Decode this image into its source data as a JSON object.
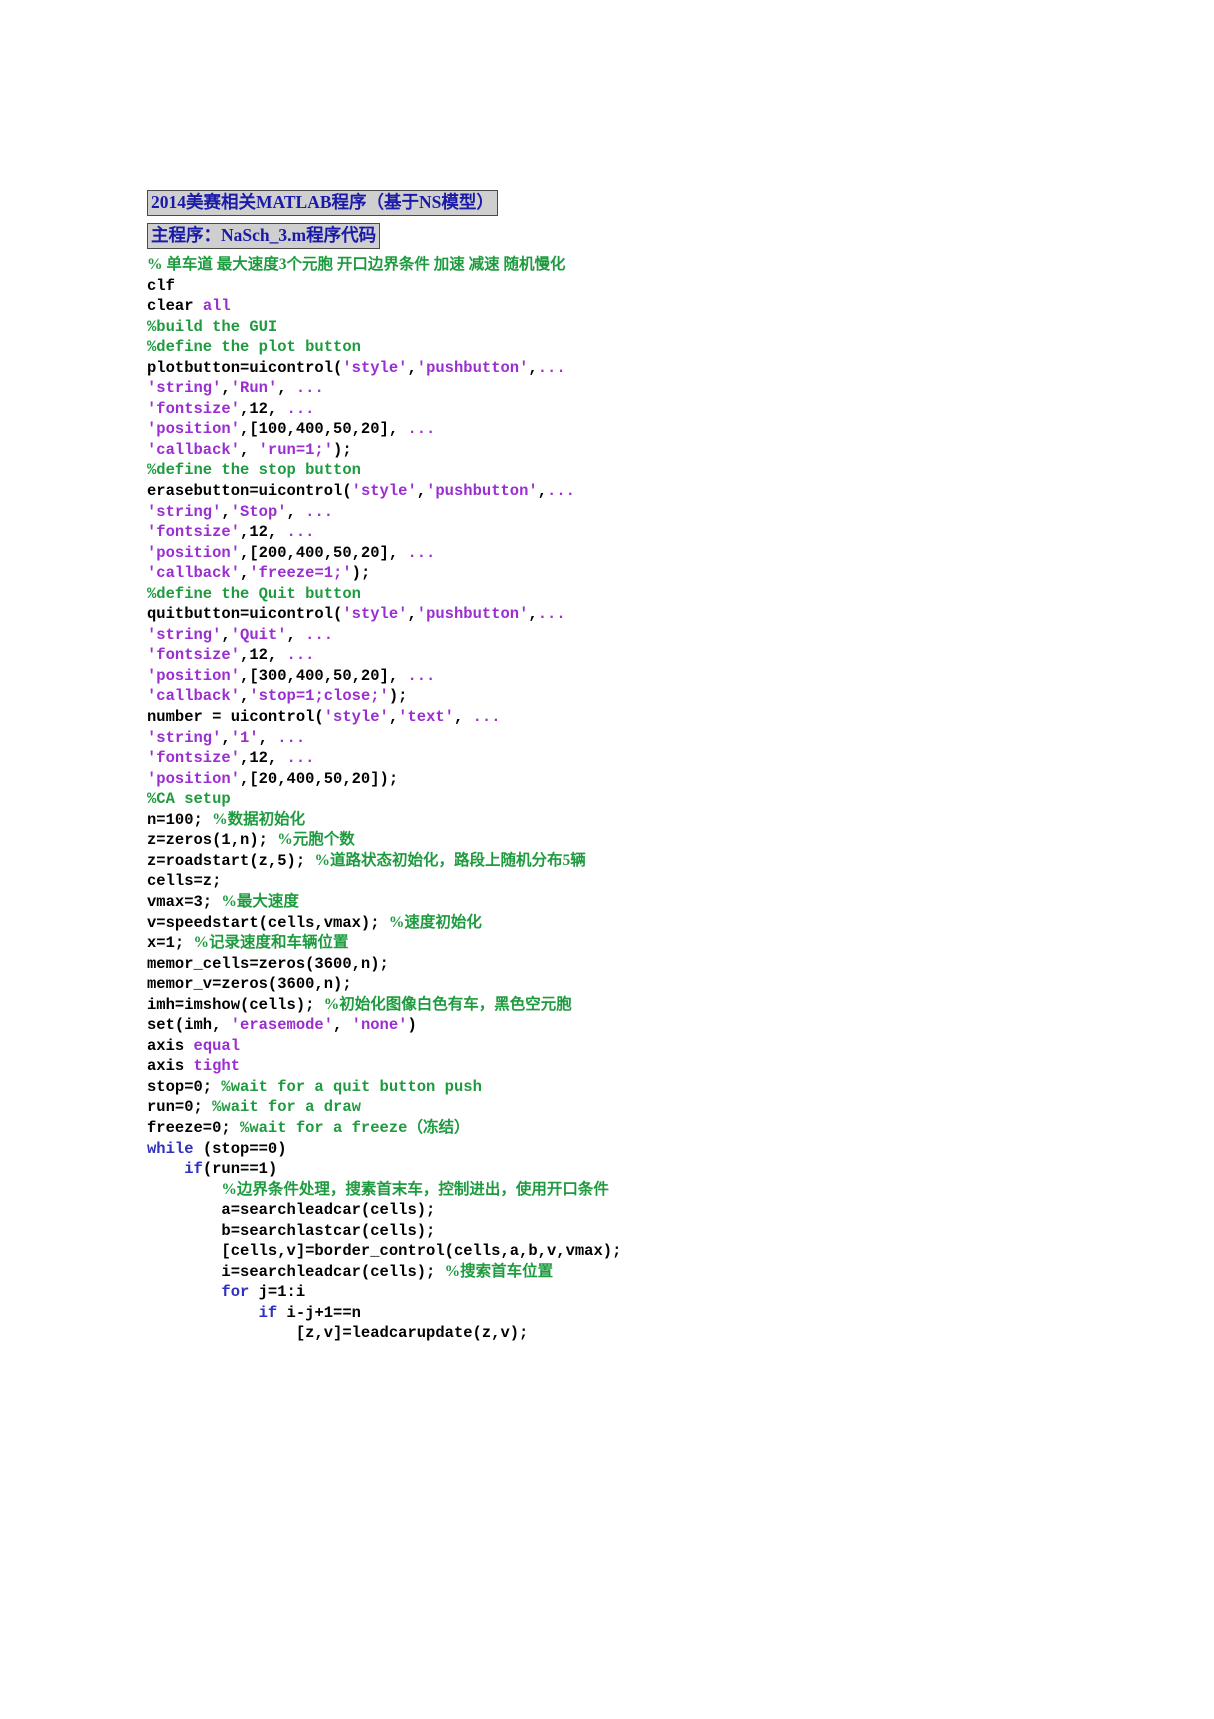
{
  "document": {
    "title_boxes": [
      "2014美赛相关MATLAB程序（基于NS模型）",
      "主程序：NaSch_3.m程序代码"
    ]
  },
  "code": {
    "language": "matlab",
    "lines": [
      [
        [
          "cmz",
          "% 单车道 最大速度3个元胞 开口边界条件 加速 减速 随机慢化"
        ]
      ],
      [
        [
          "pl",
          "clf"
        ]
      ],
      [
        [
          "pl",
          "clear "
        ],
        [
          "kw",
          "all"
        ]
      ],
      [
        [
          "cm",
          "%build the GUI"
        ]
      ],
      [
        [
          "cm",
          "%define the plot button"
        ]
      ],
      [
        [
          "pl",
          "plotbutton=uicontrol("
        ],
        [
          "st",
          "'style'"
        ],
        [
          "pl",
          ","
        ],
        [
          "st",
          "'pushbutton'"
        ],
        [
          "pl",
          ","
        ],
        [
          "st",
          "..."
        ]
      ],
      [
        [
          "st",
          "'string'"
        ],
        [
          "pl",
          ","
        ],
        [
          "st",
          "'Run'"
        ],
        [
          "pl",
          ", "
        ],
        [
          "st",
          "..."
        ]
      ],
      [
        [
          "st",
          "'fontsize'"
        ],
        [
          "pl",
          ",12, "
        ],
        [
          "st",
          "..."
        ]
      ],
      [
        [
          "st",
          "'position'"
        ],
        [
          "pl",
          ",[100,400,50,20], "
        ],
        [
          "st",
          "..."
        ]
      ],
      [
        [
          "st",
          "'callback'"
        ],
        [
          "pl",
          ", "
        ],
        [
          "st",
          "'run=1;'"
        ],
        [
          "pl",
          ");"
        ]
      ],
      [
        [
          "cm",
          "%define the stop button"
        ]
      ],
      [
        [
          "pl",
          "erasebutton=uicontrol("
        ],
        [
          "st",
          "'style'"
        ],
        [
          "pl",
          ","
        ],
        [
          "st",
          "'pushbutton'"
        ],
        [
          "pl",
          ","
        ],
        [
          "st",
          "..."
        ]
      ],
      [
        [
          "st",
          "'string'"
        ],
        [
          "pl",
          ","
        ],
        [
          "st",
          "'Stop'"
        ],
        [
          "pl",
          ", "
        ],
        [
          "st",
          "..."
        ]
      ],
      [
        [
          "st",
          "'fontsize'"
        ],
        [
          "pl",
          ",12, "
        ],
        [
          "st",
          "..."
        ]
      ],
      [
        [
          "st",
          "'position'"
        ],
        [
          "pl",
          ",[200,400,50,20], "
        ],
        [
          "st",
          "..."
        ]
      ],
      [
        [
          "st",
          "'callback'"
        ],
        [
          "pl",
          ","
        ],
        [
          "st",
          "'freeze=1;'"
        ],
        [
          "pl",
          ");"
        ]
      ],
      [
        [
          "cm",
          "%define the Quit button"
        ]
      ],
      [
        [
          "pl",
          "quitbutton=uicontrol("
        ],
        [
          "st",
          "'style'"
        ],
        [
          "pl",
          ","
        ],
        [
          "st",
          "'pushbutton'"
        ],
        [
          "pl",
          ","
        ],
        [
          "st",
          "..."
        ]
      ],
      [
        [
          "st",
          "'string'"
        ],
        [
          "pl",
          ","
        ],
        [
          "st",
          "'Quit'"
        ],
        [
          "pl",
          ", "
        ],
        [
          "st",
          "..."
        ]
      ],
      [
        [
          "st",
          "'fontsize'"
        ],
        [
          "pl",
          ",12, "
        ],
        [
          "st",
          "..."
        ]
      ],
      [
        [
          "st",
          "'position'"
        ],
        [
          "pl",
          ",[300,400,50,20], "
        ],
        [
          "st",
          "..."
        ]
      ],
      [
        [
          "st",
          "'callback'"
        ],
        [
          "pl",
          ","
        ],
        [
          "st",
          "'stop=1;close;'"
        ],
        [
          "pl",
          ");"
        ]
      ],
      [
        [
          "pl",
          "number = uicontrol("
        ],
        [
          "st",
          "'style'"
        ],
        [
          "pl",
          ","
        ],
        [
          "st",
          "'text'"
        ],
        [
          "pl",
          ", "
        ],
        [
          "st",
          "..."
        ]
      ],
      [
        [
          "st",
          "'string'"
        ],
        [
          "pl",
          ","
        ],
        [
          "st",
          "'1'"
        ],
        [
          "pl",
          ", "
        ],
        [
          "st",
          "..."
        ]
      ],
      [
        [
          "st",
          "'fontsize'"
        ],
        [
          "pl",
          ",12, "
        ],
        [
          "st",
          "..."
        ]
      ],
      [
        [
          "st",
          "'position'"
        ],
        [
          "pl",
          ",[20,400,50,20]);"
        ]
      ],
      [
        [
          "cm",
          "%CA setup"
        ]
      ],
      [
        [
          "pl",
          "n=100; "
        ],
        [
          "cmz",
          "%数据初始化"
        ]
      ],
      [
        [
          "pl",
          "z=zeros(1,n); "
        ],
        [
          "cmz",
          "%元胞个数"
        ]
      ],
      [
        [
          "pl",
          "z=roadstart(z,5); "
        ],
        [
          "cmz",
          "%道路状态初始化，路段上随机分布5辆"
        ]
      ],
      [
        [
          "pl",
          "cells=z;"
        ]
      ],
      [
        [
          "pl",
          "vmax=3; "
        ],
        [
          "cmz",
          "%最大速度"
        ]
      ],
      [
        [
          "pl",
          "v=speedstart(cells,vmax); "
        ],
        [
          "cmz",
          "%速度初始化"
        ]
      ],
      [
        [
          "pl",
          "x=1; "
        ],
        [
          "cmz",
          "%记录速度和车辆位置"
        ]
      ],
      [
        [
          "pl",
          "memor_cells=zeros(3600,n);"
        ]
      ],
      [
        [
          "pl",
          "memor_v=zeros(3600,n);"
        ]
      ],
      [
        [
          "pl",
          "imh=imshow(cells); "
        ],
        [
          "cmz",
          "%初始化图像白色有车，黑色空元胞"
        ]
      ],
      [
        [
          "pl",
          "set(imh, "
        ],
        [
          "st",
          "'erasemode'"
        ],
        [
          "pl",
          ", "
        ],
        [
          "st",
          "'none'"
        ],
        [
          "pl",
          ")"
        ]
      ],
      [
        [
          "pl",
          "axis "
        ],
        [
          "kw",
          "equal"
        ]
      ],
      [
        [
          "pl",
          "axis "
        ],
        [
          "kw",
          "tight"
        ]
      ],
      [
        [
          "pl",
          "stop=0; "
        ],
        [
          "cm",
          "%wait for a quit button push"
        ]
      ],
      [
        [
          "pl",
          "run=0; "
        ],
        [
          "cm",
          "%wait for a draw"
        ]
      ],
      [
        [
          "pl",
          "freeze=0; "
        ],
        [
          "cm",
          "%wait for a freeze（冻结）"
        ]
      ],
      [
        [
          "kwb",
          "while "
        ],
        [
          "pl",
          "(stop==0)"
        ]
      ],
      [
        [
          "pl",
          "    "
        ],
        [
          "kwb",
          "if"
        ],
        [
          "pl",
          "(run==1)"
        ]
      ],
      [
        [
          "pl",
          "        "
        ],
        [
          "cmz",
          "%边界条件处理，搜素首末车，控制进出，使用开口条件"
        ]
      ],
      [
        [
          "pl",
          "        a=searchleadcar(cells);"
        ]
      ],
      [
        [
          "pl",
          "        b=searchlastcar(cells);"
        ]
      ],
      [
        [
          "pl",
          "        [cells,v]=border_control(cells,a,b,v,vmax);"
        ]
      ],
      [
        [
          "pl",
          "        i=searchleadcar(cells); "
        ],
        [
          "cmz",
          "%搜索首车位置"
        ]
      ],
      [
        [
          "pl",
          "        "
        ],
        [
          "kwb",
          "for"
        ],
        [
          "pl",
          " j=1:i"
        ]
      ],
      [
        [
          "pl",
          "            "
        ],
        [
          "kwb",
          "if"
        ],
        [
          "pl",
          " i-j+1==n"
        ]
      ],
      [
        [
          "pl",
          "                [z,v]=leadcarupdate(z,v);"
        ]
      ]
    ]
  }
}
